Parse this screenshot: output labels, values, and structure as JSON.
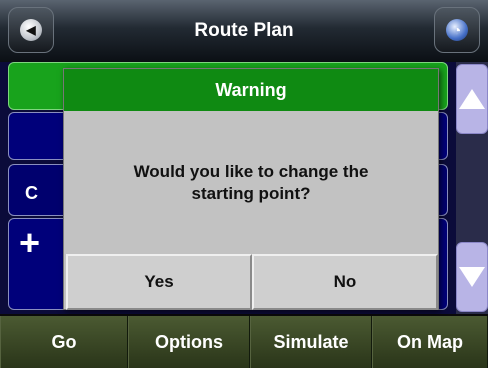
{
  "header": {
    "title": "Route Plan",
    "back_icon_glyph": "◀",
    "globe_icon_glyph": "◔"
  },
  "list": {
    "row2_letter": "C",
    "row3_symbol": "+"
  },
  "dialog": {
    "title": "Warning",
    "message_line1": "Would you like to change the",
    "message_line2": "starting point?",
    "yes_label": "Yes",
    "no_label": "No"
  },
  "toolbar": {
    "go_label": "Go",
    "options_label": "Options",
    "simulate_label": "Simulate",
    "onmap_label": "On Map"
  },
  "colors": {
    "dialog_header": "#0f8a12",
    "list_highlight": "#18a31c",
    "list_row": "#00007a",
    "dialog_body": "#c2c2c2",
    "toolbar": "#3a4726"
  },
  "icons": {
    "back": "back-arrow-icon",
    "globe": "globe-icon",
    "scroll_up": "triangle-up-icon",
    "scroll_down": "triangle-down-icon"
  }
}
